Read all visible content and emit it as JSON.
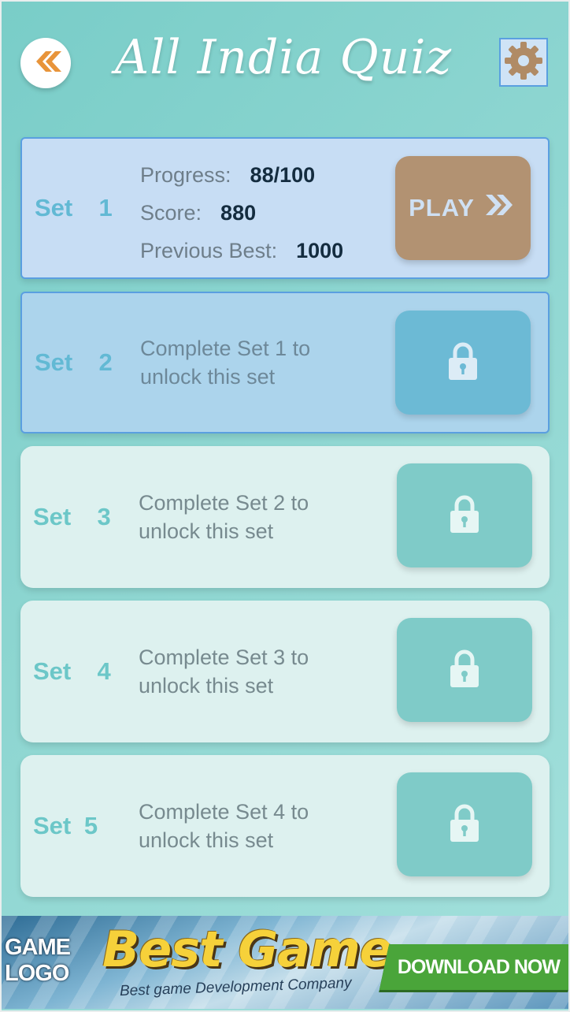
{
  "header": {
    "title": "All India Quiz",
    "back_icon": "double-chevron-left-icon",
    "settings_icon": "gear-icon"
  },
  "sets": [
    {
      "label": "Set  1",
      "state": "unlocked",
      "progress_label": "Progress:",
      "progress_value": "88/100",
      "score_label": "Score:",
      "score_value": "880",
      "best_label": "Previous Best:",
      "best_value": "1000",
      "play_label": "PLAY"
    },
    {
      "label": "Set  2",
      "state": "locked",
      "message": "Complete Set 1 to unlock this set"
    },
    {
      "label": "Set  3",
      "state": "locked",
      "message": "Complete Set 2 to unlock this set"
    },
    {
      "label": "Set  4",
      "state": "locked",
      "message": "Complete Set 3 to unlock this set"
    },
    {
      "label": "Set 5",
      "state": "locked",
      "message": "Complete Set 4 to unlock this set"
    }
  ],
  "ad": {
    "logo": "GAME LOGO",
    "headline": "Best Game",
    "subline": "Best game Development Company",
    "cta": "DOWNLOAD NOW"
  },
  "colors": {
    "background": "#8ed6d1",
    "play_button": "#b29272",
    "lock_button": "#7fcbc8",
    "set_label": "#6cc7c8",
    "back_chevron": "#e8943a",
    "gear": "#b08b66"
  }
}
